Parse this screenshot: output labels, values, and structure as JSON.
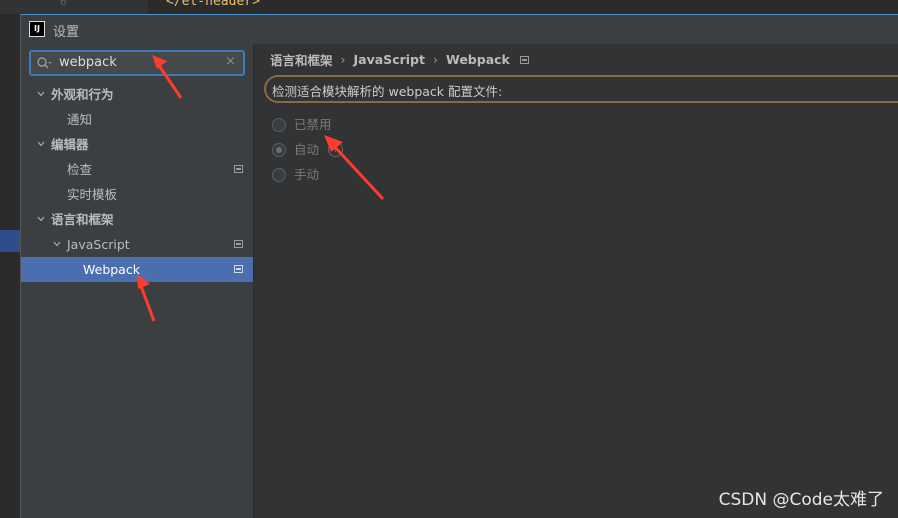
{
  "editor": {
    "line_number": "6",
    "code_line": "</el-header>"
  },
  "window": {
    "logo_text": "IJ",
    "title": "设置"
  },
  "search": {
    "value": "webpack",
    "clear_glyph": "×"
  },
  "tree": {
    "items": [
      {
        "label": "外观和行为",
        "level": 0,
        "expanded": true
      },
      {
        "label": "通知",
        "level": 1
      },
      {
        "label": "编辑器",
        "level": 0,
        "expanded": true
      },
      {
        "label": "检查",
        "level": 1,
        "project": true
      },
      {
        "label": "实时模板",
        "level": 1
      },
      {
        "label": "语言和框架",
        "level": 0,
        "expanded": true
      },
      {
        "label": "JavaScript",
        "level": 1,
        "expanded": true,
        "project": true
      },
      {
        "label": "Webpack",
        "level": 2,
        "selected": true,
        "project": true
      }
    ]
  },
  "breadcrumb": {
    "part1": "语言和框架",
    "part2": "JavaScript",
    "part3": "Webpack",
    "separator": "›"
  },
  "webpack": {
    "detect_label": "检测适合模块解析的 webpack 配置文件:",
    "options": [
      {
        "label": "已禁用",
        "checked": false
      },
      {
        "label": "自动",
        "checked": true,
        "help": "?"
      },
      {
        "label": "手动",
        "checked": false
      }
    ]
  },
  "watermark": "CSDN @Code太难了",
  "colors": {
    "accent": "#4b6eaf",
    "search_border": "#3d7ab8",
    "focus_border": "#8b6a3e",
    "annotation": "#ff3b30"
  }
}
